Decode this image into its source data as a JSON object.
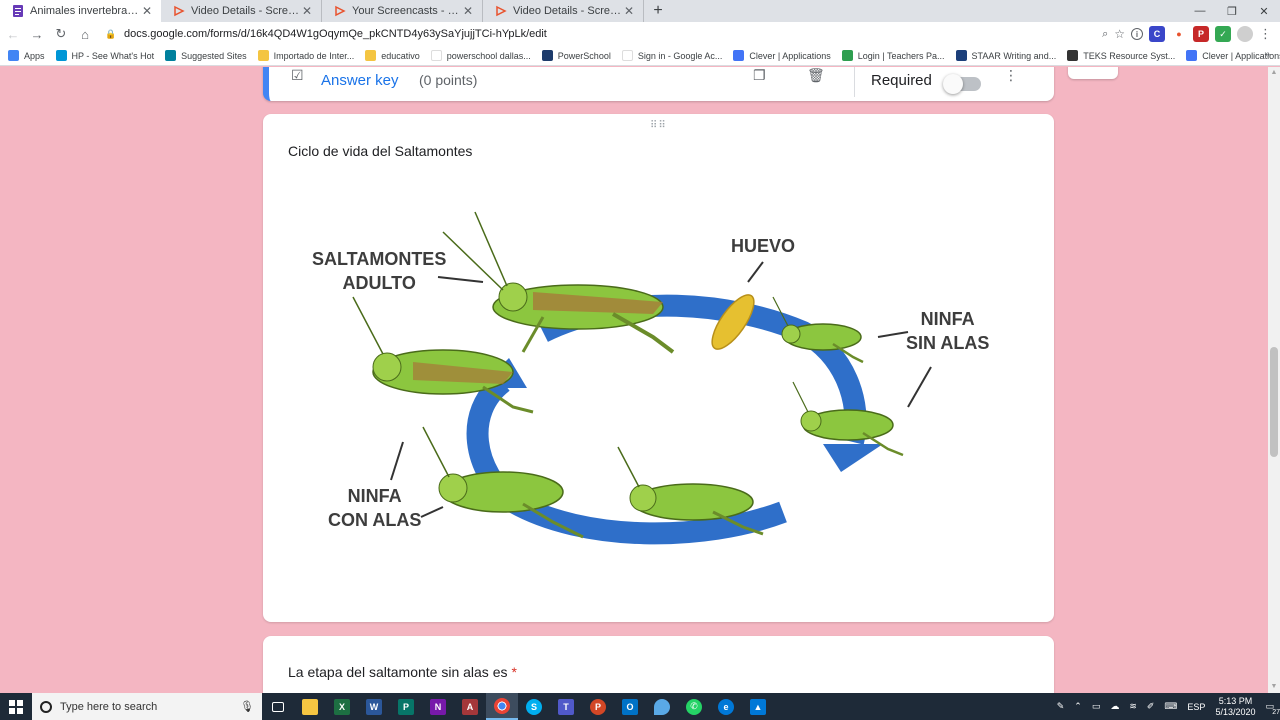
{
  "tabs": [
    {
      "title": "Animales invertebrados - Google Forms",
      "active": true,
      "icon": "forms-icon"
    },
    {
      "title": "Video Details - Screencastify",
      "active": false,
      "icon": "screencastify-icon"
    },
    {
      "title": "Your Screencasts - Screencastify",
      "active": false,
      "icon": "screencastify-icon"
    },
    {
      "title": "Video Details - Screencastify",
      "active": false,
      "icon": "screencastify-icon"
    }
  ],
  "toolbar": {
    "url": "docs.google.com/forms/d/16k4QD4W1gOqymQe_pkCNTD4y63ySaYjujjTCi-hYpLk/edit"
  },
  "bookmarks": [
    {
      "label": "Apps",
      "icon": "apps-grid-icon",
      "color": "#4285f4"
    },
    {
      "label": "HP - See What's Hot",
      "icon": "hp-icon",
      "color": "#0096d6"
    },
    {
      "label": "Suggested Sites",
      "icon": "bing-icon",
      "color": "#00809d"
    },
    {
      "label": "Importado de Inter...",
      "icon": "folder-icon",
      "color": "#f4c542"
    },
    {
      "label": "educativo",
      "icon": "folder-icon",
      "color": "#f4c542"
    },
    {
      "label": "powerschool dallas...",
      "icon": "google-icon",
      "color": "#ffffff"
    },
    {
      "label": "PowerSchool",
      "icon": "powerschool-icon",
      "color": "#1d3b6b"
    },
    {
      "label": "Sign in - Google Ac...",
      "icon": "google-icon",
      "color": "#ffffff"
    },
    {
      "label": "Clever | Applications",
      "icon": "clever-icon",
      "color": "#4274f6"
    },
    {
      "label": "Login | Teachers Pa...",
      "icon": "teachers-pay-icon",
      "color": "#2e9e4f"
    },
    {
      "label": "STAAR Writing and...",
      "icon": "tea-icon",
      "color": "#1c3f7a"
    },
    {
      "label": "TEKS Resource Syst...",
      "icon": "gear-icon",
      "color": "#333333"
    },
    {
      "label": "Clever | Applications",
      "icon": "clever-icon",
      "color": "#4274f6"
    }
  ],
  "form": {
    "top_card": {
      "answer_key": "Answer key",
      "points": "(0 points)",
      "required": "Required"
    },
    "image_card": {
      "title": "Ciclo de vida del Saltamontes",
      "figure_labels": {
        "adult": [
          "SALTAMONTES",
          "ADULTO"
        ],
        "egg": "HUEVO",
        "nymph_no_wings": [
          "NINFA",
          "SIN ALAS"
        ],
        "nymph_wings": [
          "NINFA",
          "CON ALAS"
        ]
      }
    },
    "question_card": {
      "title": "La etapa del saltamonte sin alas es",
      "required_marker": "*"
    }
  },
  "taskbar": {
    "search_placeholder": "Type here to search",
    "language": "ESP",
    "time": "5:13 PM",
    "date": "5/13/2020",
    "notification_count": "27"
  },
  "colors": {
    "page_bg": "#f4b6c2",
    "accent": "#4285f4",
    "cycle_arrow": "#2f6fc9",
    "grasshopper": "#8cc63f"
  }
}
